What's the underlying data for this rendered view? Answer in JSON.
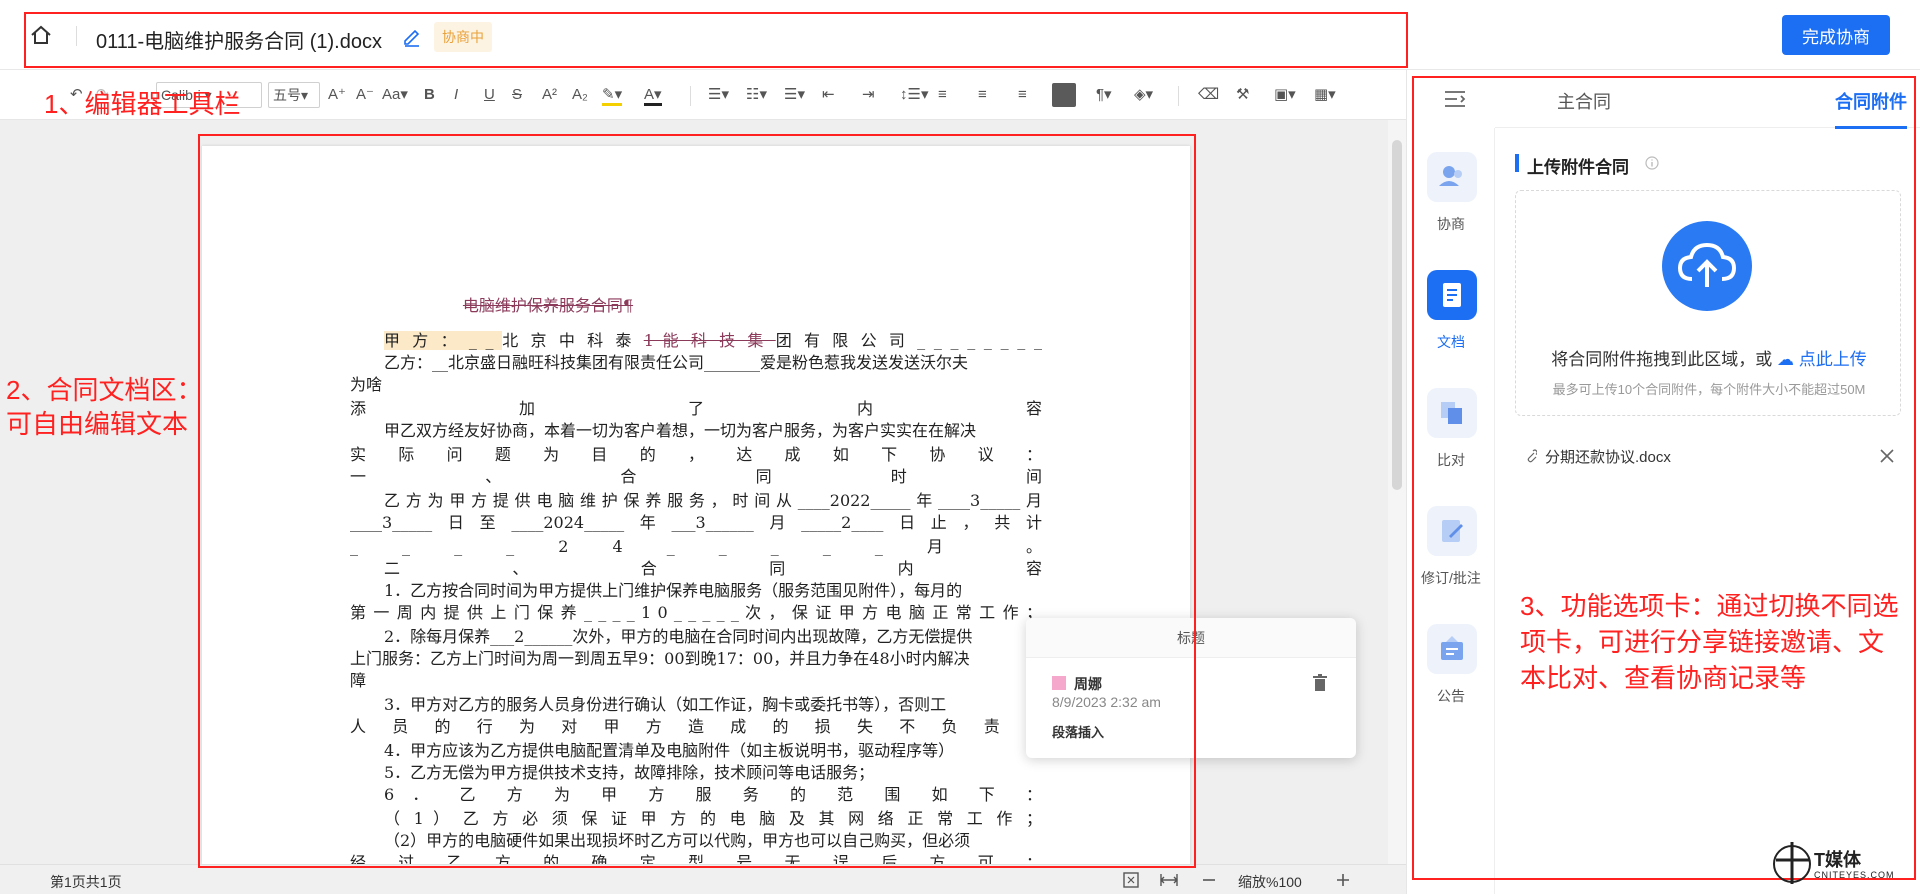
{
  "header": {
    "doc_title": "0111-电脑维护服务合同 (1).docx",
    "status": "协商中",
    "finish_button": "完成协商"
  },
  "toolbar": {
    "font_name": "Calibri",
    "font_size": "五号",
    "case_label": "Aa"
  },
  "document": {
    "heading": "电脑维护保养服务合同¶",
    "lines": {
      "l1_a": "甲 方 ： _ _ ",
      "l1_b": "北 京 中 科 泰 ",
      "l1_c": "1 能 科 技 集 ",
      "l1_d": "团 有 限 公 司 _ _ _ _ _ _ _ _",
      "l2": "乙方：__北京盛日融旺科技集团有限责任公司_______爱是粉色惹我发送发送沃尔夫",
      "l3": "为啥",
      "l4": "添 加 了 内 容",
      "l5": "甲乙双方经友好协商，本着一切为客户着想，一切为客户服务，为客户实实在在解决",
      "l6": "实 际 问 题 为 目 的 ， 达 成 如 下 协 议 ：",
      "l7": "一 、 合 同 时 间",
      "l8": "乙方为甲方提供电脑维护保养服务，时间从____2022_____年____3_____月",
      "l9": "____3_____日至____2024_____年___3______月_____2____日止，共计",
      "l10": "_ _ _ _ 2 4 _ _ _ _ _ 月 。",
      "l11": "二 、 合 同 内 容",
      "l12": "1．乙方按合同时间为甲方提供上门维护保养电脑服务（服务范围见附件），每月的",
      "l13": "第 一 周 内 提 供 上 门 保 养 _ _ _ _ 1 0 _ _ _ _ _ 次 ， 保 证 甲 方 电 脑 正 常 工 作 ；",
      "l14": "2．除每月保养___2______次外，甲方的电脑在合同时间内出现故障，乙方无偿提供",
      "l15": "上门服务：乙方上门时间为周一到周五早9：00到晚17：00，并且力争在48小时内解决",
      "l16": "障",
      "l17": "3．甲方对乙方的服务人员身份进行确认（如工作证，胸卡或委托书等），否则工",
      "l18": "人 员 的 行 为 对 甲 方 造 成 的 损 失 不 负 责 任",
      "l19": "4．甲方应该为乙方提供电脑配置清单及电脑附件（如主板说明书，驱动程序等）",
      "l20": "5．乙方无偿为甲方提供技术支持，故障排除，技术顾问等电话服务；",
      "l21": "6 ． 乙 方 为 甲 方 服 务 的 范 围 如 下 ：",
      "l22": "（ 1 ） 乙 方 必 须 保 证 甲 方 的 电 脑 及 其 网 络 正 常 工 作 ；",
      "l23": "（2）甲方的电脑硬件如果出现损坏时乙方可以代购，甲方也可以自己购买，但必须",
      "l24": "经 过 乙 方 的 确 定 型 号 无 误 后 方 可 ；"
    }
  },
  "comment": {
    "header": "标题",
    "user": "周娜",
    "time": "8/9/2023 2:32 am",
    "text": "段落插入"
  },
  "statusbar": {
    "page_info": "第1页共1页",
    "zoom": "缩放%100"
  },
  "right_panel": {
    "tabs": [
      "主合同",
      "合同附件"
    ],
    "active_tab": "合同附件",
    "side_nav": [
      {
        "label": "协商",
        "icon": "users-icon"
      },
      {
        "label": "文档",
        "icon": "document-icon"
      },
      {
        "label": "比对",
        "icon": "compare-icon"
      },
      {
        "label": "修订/批注",
        "icon": "annotate-icon"
      },
      {
        "label": "公告",
        "icon": "announcement-icon"
      }
    ],
    "section_title": "上传附件合同",
    "upload_text": "将合同附件拖拽到此区域，或",
    "upload_link": "点此上传",
    "upload_hint": "最多可上传10个合同附件，每个附件大小不能超过50M",
    "file_name": "分期还款协议.docx"
  },
  "annotations": {
    "a1": "1、编辑器工具栏",
    "a2_line1": "2、合同文档区：",
    "a2_line2": "可自由编辑文本",
    "a3_line1": "3、功能选项卡：通过切换不同选",
    "a3_line2": "项卡，可进行分享链接邀请、文",
    "a3_line3": "本比对、查看协商记录等"
  },
  "watermark": {
    "name": "T媒体",
    "sub": "CNITEYES.COM"
  },
  "colors": {
    "accent": "#1c6ef2",
    "annotation": "#ff2020",
    "status": "#e9a23b"
  }
}
